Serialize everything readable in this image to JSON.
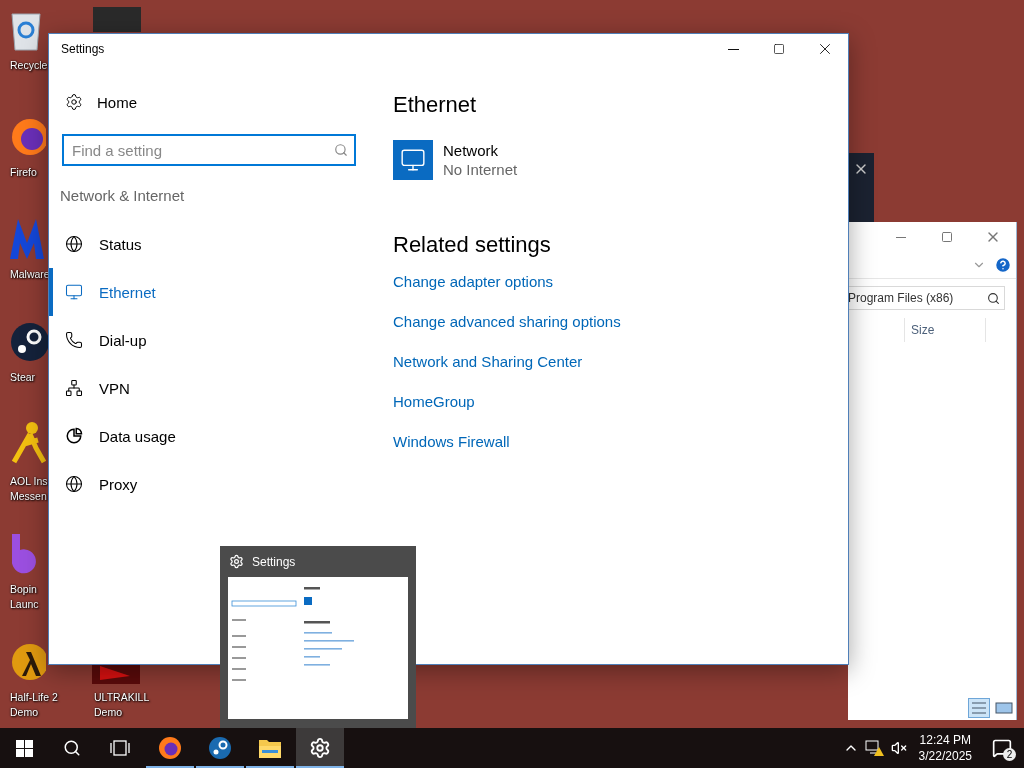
{
  "desktop_icons": [
    {
      "kind": "recycle",
      "lines": [
        "Recycle"
      ]
    },
    {
      "kind": "firefox",
      "lines": [
        "Firefo"
      ]
    },
    {
      "kind": "malware",
      "lines": [
        "Malware"
      ]
    },
    {
      "kind": "steam",
      "lines": [
        "Stear"
      ]
    },
    {
      "kind": "aol",
      "lines": [
        "AOL Ins",
        "Messen"
      ]
    },
    {
      "kind": "bop",
      "lines": [
        "Bopin",
        "Launc"
      ]
    },
    {
      "kind": "halflife",
      "lines": [
        "Half-Life 2",
        "Demo"
      ]
    },
    {
      "kind": "ultrakill",
      "lines": [
        "ULTRAKILL",
        "Demo"
      ]
    }
  ],
  "settings_window": {
    "title": "Settings",
    "nav": {
      "home": "Home",
      "search_placeholder": "Find a setting",
      "section": "Network & Internet",
      "items": [
        {
          "kind": "status",
          "label": "Status",
          "selected": false
        },
        {
          "kind": "ethernet",
          "label": "Ethernet",
          "selected": true
        },
        {
          "kind": "dialup",
          "label": "Dial-up",
          "selected": false
        },
        {
          "kind": "vpn",
          "label": "VPN",
          "selected": false
        },
        {
          "kind": "data",
          "label": "Data usage",
          "selected": false
        },
        {
          "kind": "proxy",
          "label": "Proxy",
          "selected": false
        }
      ]
    },
    "content": {
      "heading": "Ethernet",
      "network": {
        "name": "Network",
        "status": "No Internet"
      },
      "related_heading": "Related settings",
      "links": [
        "Change adapter options",
        "Change advanced sharing options",
        "Network and Sharing Center",
        "HomeGroup",
        "Windows Firewall"
      ]
    }
  },
  "explorer_window": {
    "search_value": "Program Files (x86)",
    "columns": [
      "Size"
    ]
  },
  "taskbar_preview": {
    "title": "Settings"
  },
  "taskbar": {
    "apps": [
      {
        "kind": "firefox",
        "running": true,
        "selected": false
      },
      {
        "kind": "steam",
        "running": true,
        "selected": false
      },
      {
        "kind": "explorer",
        "running": true,
        "selected": false
      },
      {
        "kind": "settings",
        "running": true,
        "selected": true
      }
    ],
    "time": "12:24 PM",
    "date": "3/22/2025",
    "notifications": "2"
  }
}
